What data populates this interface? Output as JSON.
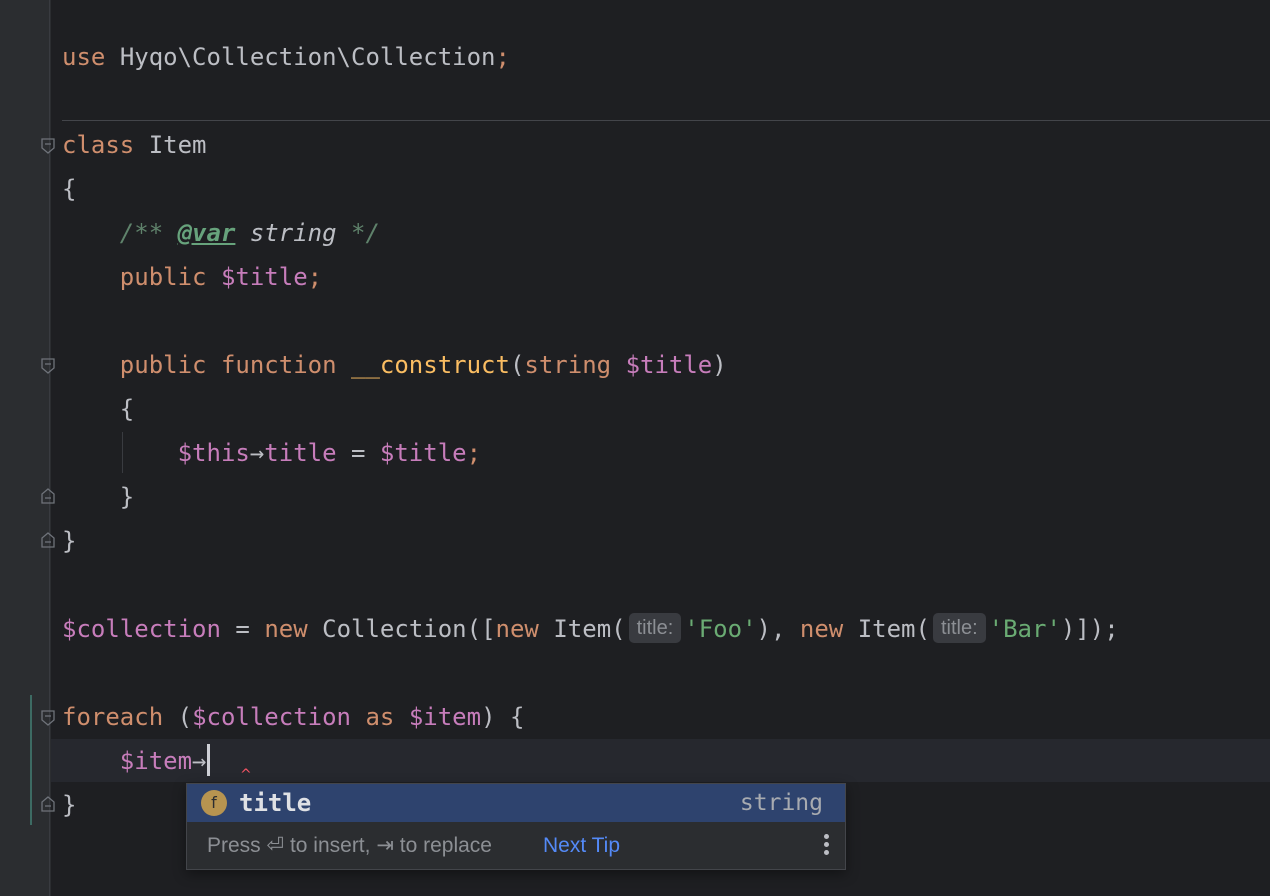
{
  "code": {
    "use_kw": "use",
    "use_ns": "Hyqo\\Collection\\Collection",
    "semicolon": ";",
    "class_kw": "class",
    "class_name": "Item",
    "brace_open": "{",
    "brace_close": "}",
    "doc_open": "/**",
    "doc_tag": "@var",
    "doc_type": "string",
    "doc_close": "*/",
    "public_kw": "public",
    "title_var": "$title",
    "function_kw": "function",
    "construct_name": "__construct",
    "paren_open": "(",
    "paren_close": ")",
    "string_type": "string",
    "this_var": "$this",
    "arrow": "→",
    "title_prop": "title",
    "assign": " = ",
    "collection_var": "$collection",
    "new_kw": "new",
    "collection_class": "Collection",
    "bracket_open": "([",
    "item_open": "Item(",
    "hint_title": "title:",
    "str_foo": "'Foo'",
    "str_bar": "'Bar'",
    "comma": "), ",
    "close_all": ")]);",
    "close_paren": ")",
    "foreach_kw": "foreach",
    "as_kw": "as",
    "item_var": "$item"
  },
  "autocomplete": {
    "icon_letter": "f",
    "item_name": "title",
    "item_type": "string",
    "footer_text": "Press ⏎ to insert, ⇥ to replace",
    "next_tip": "Next Tip"
  },
  "colors": {
    "keyword": "#cf8e6d",
    "variable": "#c77dbb",
    "string": "#6aab73",
    "selection": "#2e436e",
    "link": "#548af7"
  }
}
